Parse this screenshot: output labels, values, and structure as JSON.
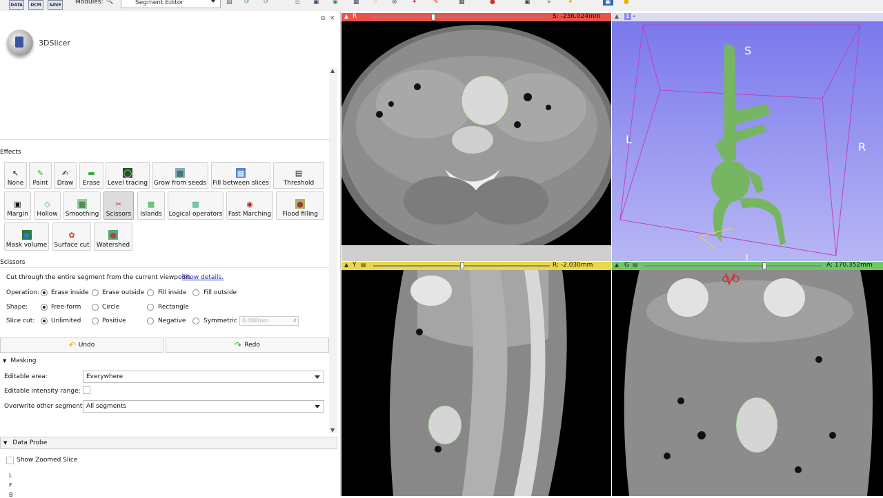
{
  "toolbar": {
    "data_label": "DATA",
    "dcm_label": "DCM",
    "save_label": "SAVE",
    "modules_label": "Modules:",
    "module_selected": "Segment Editor"
  },
  "logo": {
    "text": "3DSlicer"
  },
  "effects": {
    "title": "Effects",
    "row1": [
      "None",
      "Paint",
      "Draw",
      "Erase",
      "Level tracing",
      "Grow from seeds",
      "Fill between slices",
      "Threshold"
    ],
    "row2": [
      "Margin",
      "Hollow",
      "Smoothing",
      "Scissors",
      "Islands",
      "Logical operators",
      "Fast Marching",
      "Flood filling"
    ],
    "row3": [
      "Mask volume",
      "Surface cut",
      "Watershed"
    ],
    "active": "Scissors"
  },
  "scissors": {
    "title": "Scissors",
    "description": "Cut through the entire segment from the current viewpoint.",
    "show_details": "Show details.",
    "operation_label": "Operation:",
    "operation_options": [
      "Erase inside",
      "Erase outside",
      "Fill inside",
      "Fill outside"
    ],
    "shape_label": "Shape:",
    "shape_options": [
      "Free-form",
      "Circle",
      "Rectangle"
    ],
    "slicecut_label": "Slice cut:",
    "slicecut_options": [
      "Unlimited",
      "Positive",
      "Negative",
      "Symmetric"
    ],
    "thickness_placeholder": "0.000mm"
  },
  "undo_label": "Undo",
  "redo_label": "Redo",
  "masking": {
    "title": "Masking",
    "editable_area_label": "Editable area:",
    "editable_area_value": "Everywhere",
    "intensity_label": "Editable intensity range:",
    "overwrite_label": "Overwrite other segments:",
    "overwrite_value": "All segments"
  },
  "data_probe": {
    "title": "Data Probe",
    "show_zoomed": "Show Zoomed Slice",
    "rows": [
      "L",
      "F",
      "B"
    ]
  },
  "views": {
    "red": {
      "letter": "R",
      "offset": "S: -236.024mm",
      "color": "#e8534a"
    },
    "yellow": {
      "letter": "Y",
      "offset": "R: -2.030mm",
      "color": "#e8d84a"
    },
    "green": {
      "letter": "G",
      "offset": "A: 170.352mm",
      "color": "#6ec66a"
    },
    "threed": {
      "letter": "1",
      "labels": {
        "S": "S",
        "L": "L",
        "R": "R",
        "I": "I"
      },
      "bg": "#8e8cf0"
    }
  },
  "colors": {
    "segment": "#76b662",
    "box": "#c040c0"
  }
}
